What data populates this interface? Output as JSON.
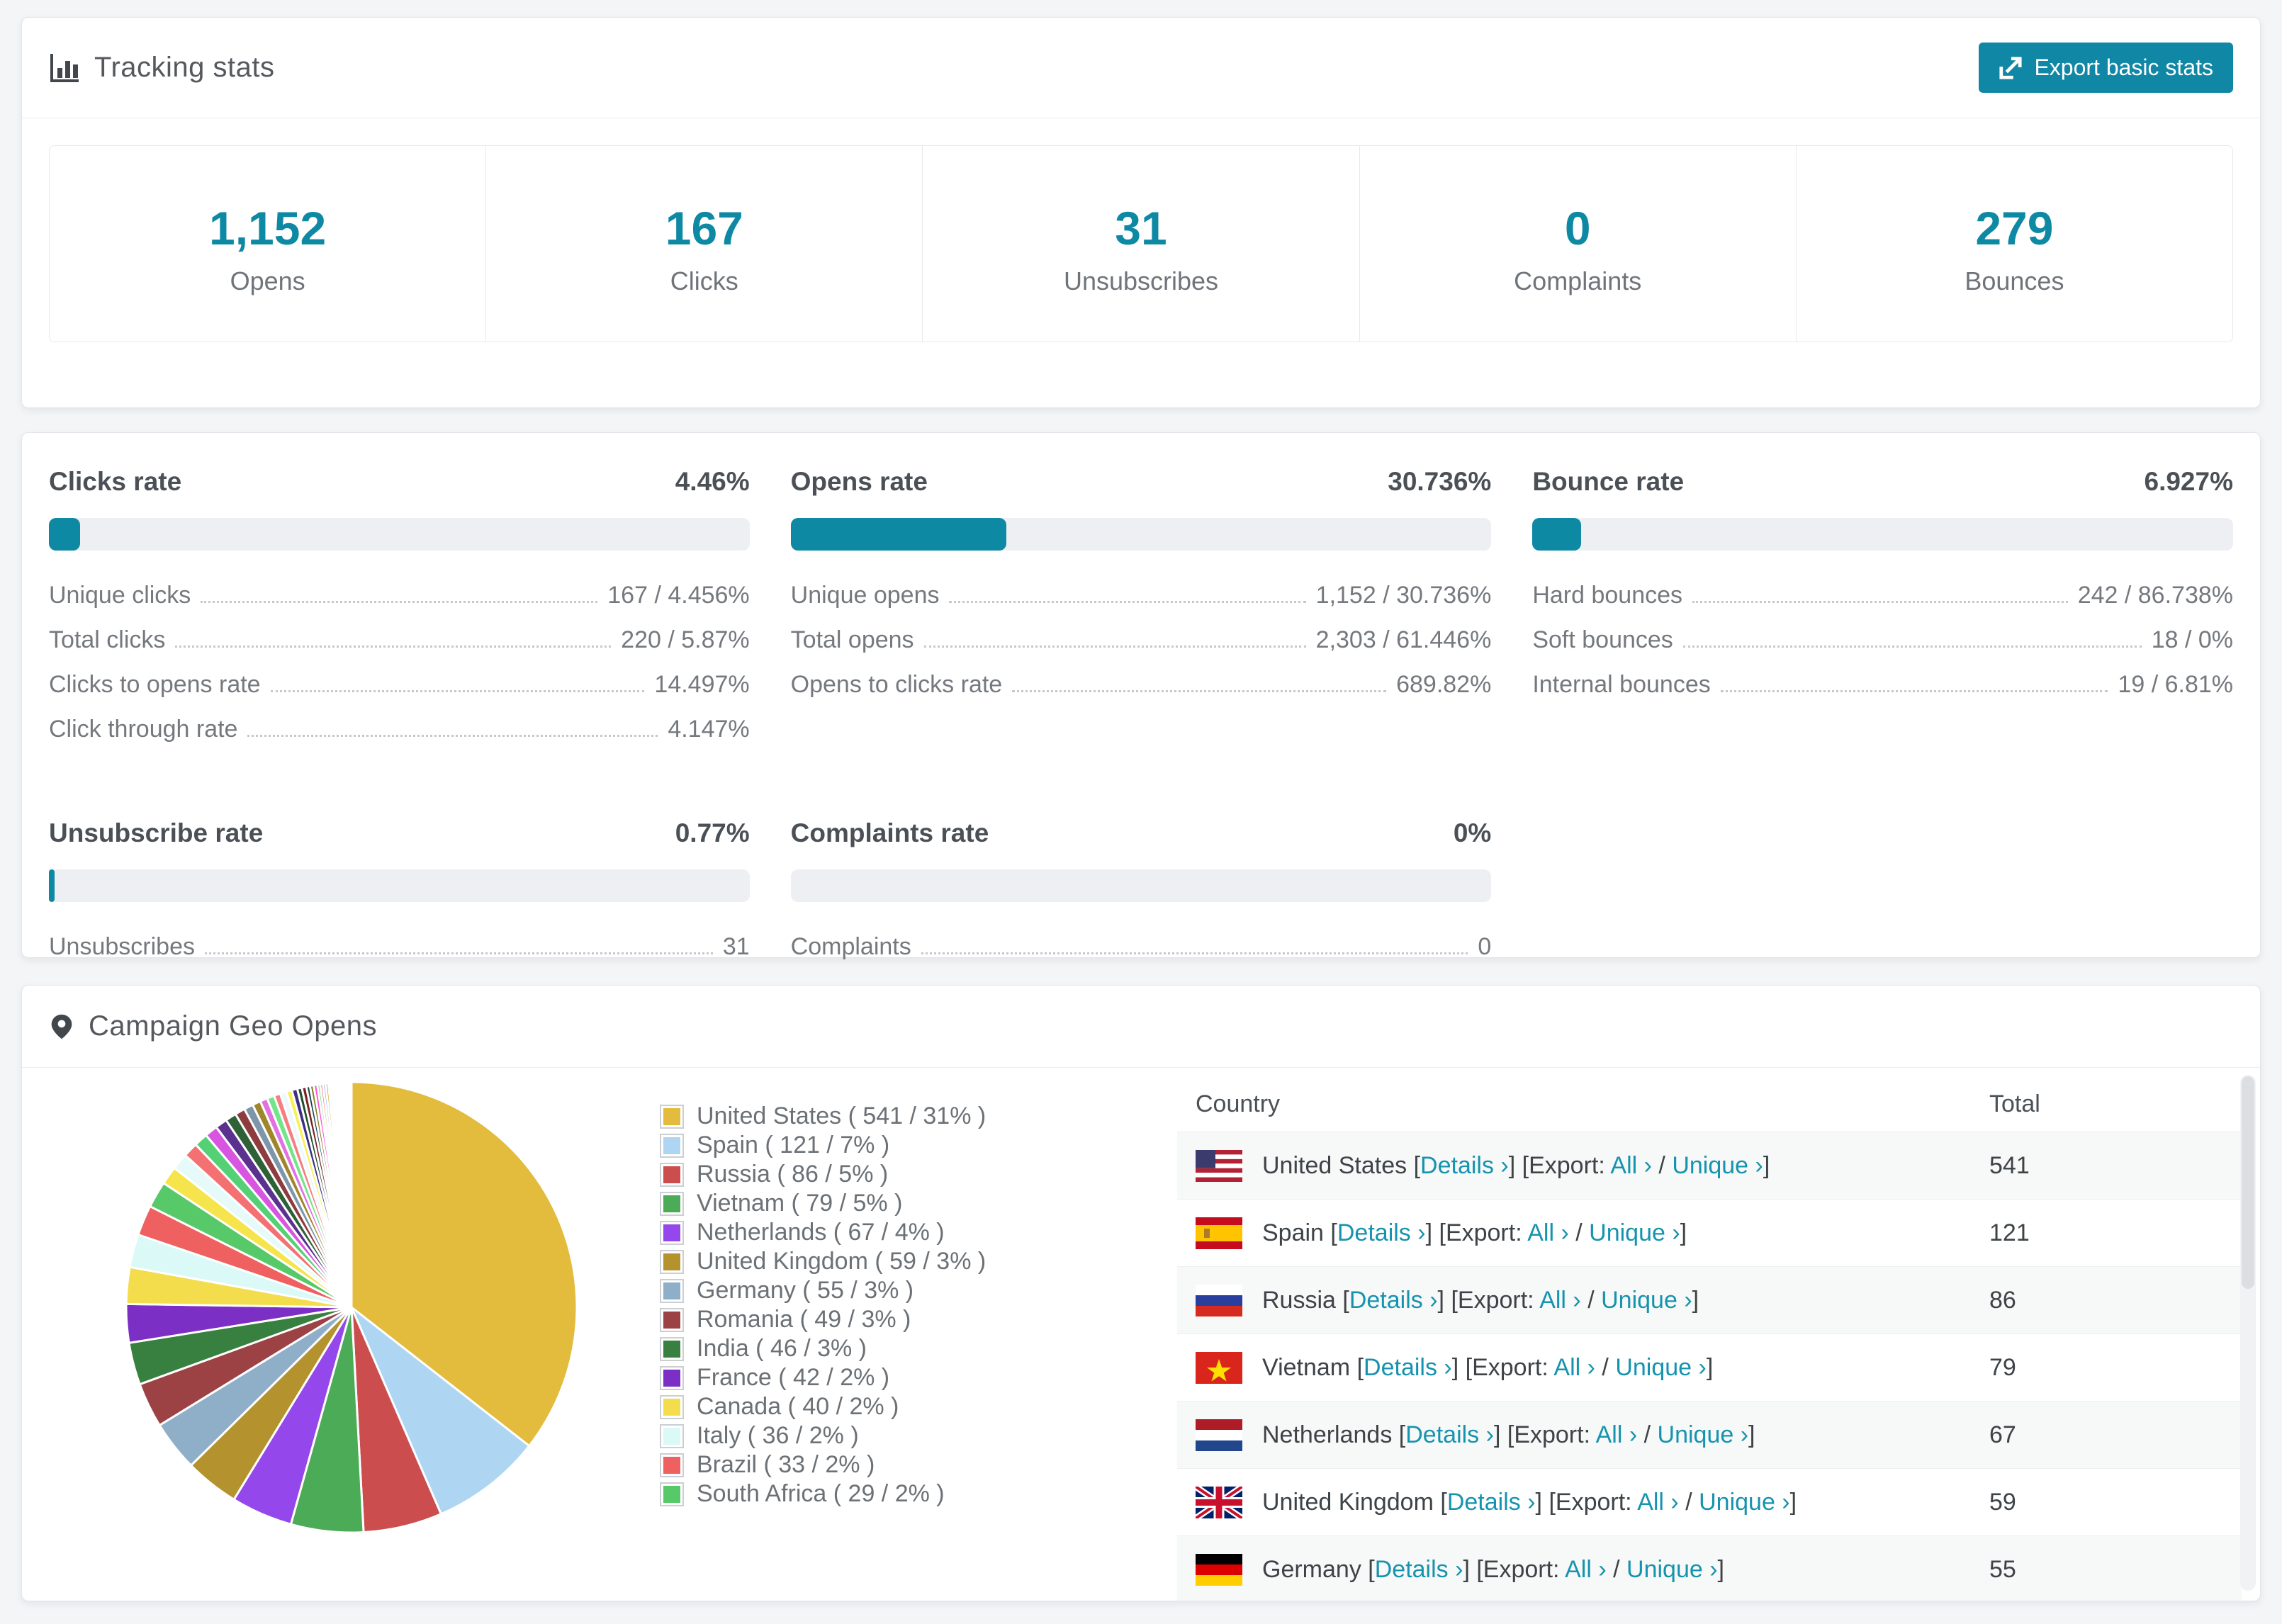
{
  "tracking": {
    "title": "Tracking stats",
    "export_button": "Export basic stats",
    "stats": [
      {
        "value": "1,152",
        "label": "Opens"
      },
      {
        "value": "167",
        "label": "Clicks"
      },
      {
        "value": "31",
        "label": "Unsubscribes"
      },
      {
        "value": "0",
        "label": "Complaints"
      },
      {
        "value": "279",
        "label": "Bounces"
      }
    ]
  },
  "accent_color": "#0e89a3",
  "rates": [
    {
      "title": "Clicks rate",
      "value": "4.46%",
      "percent": 4.46,
      "rows": [
        {
          "label": "Unique clicks",
          "value": "167 / 4.456%"
        },
        {
          "label": "Total clicks",
          "value": "220 / 5.87%"
        },
        {
          "label": "Clicks to opens rate",
          "value": "14.497%"
        },
        {
          "label": "Click through rate",
          "value": "4.147%"
        }
      ]
    },
    {
      "title": "Opens rate",
      "value": "30.736%",
      "percent": 30.736,
      "rows": [
        {
          "label": "Unique opens",
          "value": "1,152 / 30.736%"
        },
        {
          "label": "Total opens",
          "value": "2,303 / 61.446%"
        },
        {
          "label": "Opens to clicks rate",
          "value": "689.82%"
        }
      ]
    },
    {
      "title": "Bounce rate",
      "value": "6.927%",
      "percent": 6.927,
      "rows": [
        {
          "label": "Hard bounces",
          "value": "242 / 86.738%"
        },
        {
          "label": "Soft bounces",
          "value": "18 / 0%"
        },
        {
          "label": "Internal bounces",
          "value": "19 / 6.81%"
        }
      ]
    },
    {
      "title": "Unsubscribe rate",
      "value": "0.77%",
      "percent": 0.77,
      "rows": [
        {
          "label": "Unsubscribes",
          "value": "31"
        }
      ]
    },
    {
      "title": "Complaints rate",
      "value": "0%",
      "percent": 0,
      "rows": [
        {
          "label": "Complaints",
          "value": "0"
        }
      ]
    }
  ],
  "geo": {
    "title": "Campaign Geo Opens",
    "chart_data": {
      "type": "pie",
      "title": "Campaign Geo Opens",
      "legend_position": "right",
      "start_angle_deg": -90,
      "direction": "clockwise",
      "series": [
        {
          "name": "United States",
          "value": 541,
          "pct": 31,
          "color": "#e3bb3d",
          "label": "United States ( 541 / 31% )"
        },
        {
          "name": "Spain",
          "value": 121,
          "pct": 7,
          "color": "#aed5f2",
          "label": "Spain ( 121 / 7% )"
        },
        {
          "name": "Russia",
          "value": 86,
          "pct": 5,
          "color": "#cc4d4d",
          "label": "Russia ( 86 / 5% )"
        },
        {
          "name": "Vietnam",
          "value": 79,
          "pct": 5,
          "color": "#4cab57",
          "label": "Vietnam ( 79 / 5% )"
        },
        {
          "name": "Netherlands",
          "value": 67,
          "pct": 4,
          "color": "#9447ea",
          "label": "Netherlands ( 67 / 4% )"
        },
        {
          "name": "United Kingdom",
          "value": 59,
          "pct": 3,
          "color": "#b4922e",
          "label": "United Kingdom ( 59 / 3% )"
        },
        {
          "name": "Germany",
          "value": 55,
          "pct": 3,
          "color": "#8fafc9",
          "label": "Germany ( 55 / 3% )"
        },
        {
          "name": "Romania",
          "value": 49,
          "pct": 3,
          "color": "#9c4244",
          "label": "Romania ( 49 / 3% )"
        },
        {
          "name": "India",
          "value": 46,
          "pct": 3,
          "color": "#38803f",
          "label": "India ( 46 / 3% )"
        },
        {
          "name": "France",
          "value": 42,
          "pct": 2,
          "color": "#7b2fc4",
          "label": "France ( 42 / 2% )"
        },
        {
          "name": "Canada",
          "value": 40,
          "pct": 2,
          "color": "#f3dd4d",
          "label": "Canada ( 40 / 2% )"
        },
        {
          "name": "Italy",
          "value": 36,
          "pct": 2,
          "color": "#daf9f7",
          "label": "Italy ( 36 / 2% )"
        },
        {
          "name": "Brazil",
          "value": 33,
          "pct": 2,
          "color": "#ef6060",
          "label": "Brazil ( 33 / 2% )"
        },
        {
          "name": "South Africa",
          "value": 29,
          "pct": 2,
          "color": "#57c969",
          "label": "South Africa ( 29 / 2% )"
        }
      ],
      "other_segments": {
        "note": "unlabeled long tail of small countries",
        "values": [
          20,
          18,
          16,
          15,
          14,
          13,
          12,
          11,
          10,
          9,
          8,
          8,
          7,
          7,
          6,
          6,
          5,
          5,
          4,
          4,
          4,
          3,
          3,
          3,
          3,
          2,
          2,
          2,
          2,
          2,
          1,
          1,
          1,
          1,
          1,
          1,
          1,
          1,
          1,
          1,
          1,
          1,
          1,
          1,
          1
        ],
        "colors": [
          "#f6e44c",
          "#e6fbf9",
          "#f37173",
          "#55d175",
          "#d855e2",
          "#5b3190",
          "#2f6137",
          "#8f3c3e",
          "#7e96aa",
          "#a0862a",
          "#e271e2",
          "#72e58a",
          "#f57f7f",
          "#eef8ff",
          "#f8f058",
          "#3e3184",
          "#1f502d",
          "#7c2222",
          "#12414f",
          "#8d7d20",
          "#ff55da",
          "#49e271",
          "#ff5e5e",
          "#8db7ea",
          "#d6a41a",
          "#7d3feb",
          "#3d62db",
          "#309059",
          "#ea4343",
          "#ff88c4",
          "#c91788",
          "#4d0f86",
          "#838300",
          "#ff8f04",
          "#04d0d3",
          "#9c35cf",
          "#92bf92",
          "#ec9a7d",
          "#586e31",
          "#ff6cb6",
          "#2292ff",
          "#dca722",
          "#62a1a3",
          "#de1747",
          "#6e9026"
        ]
      }
    },
    "table": {
      "headers": {
        "country": "Country",
        "total": "Total"
      },
      "rows": [
        {
          "country": "United States",
          "flag": "us",
          "total": "541"
        },
        {
          "country": "Spain",
          "flag": "es",
          "total": "121"
        },
        {
          "country": "Russia",
          "flag": "ru",
          "total": "86"
        },
        {
          "country": "Vietnam",
          "flag": "vn",
          "total": "79"
        },
        {
          "country": "Netherlands",
          "flag": "nl",
          "total": "67"
        },
        {
          "country": "United Kingdom",
          "flag": "gb",
          "total": "59"
        },
        {
          "country": "Germany",
          "flag": "de",
          "total": "55"
        }
      ],
      "links": {
        "details": "Details ›",
        "export_label": "Export:",
        "all": "All ›",
        "unique": "Unique ›"
      },
      "punct": {
        "lb": "[",
        "rb": "]",
        "slash": "/"
      }
    }
  }
}
